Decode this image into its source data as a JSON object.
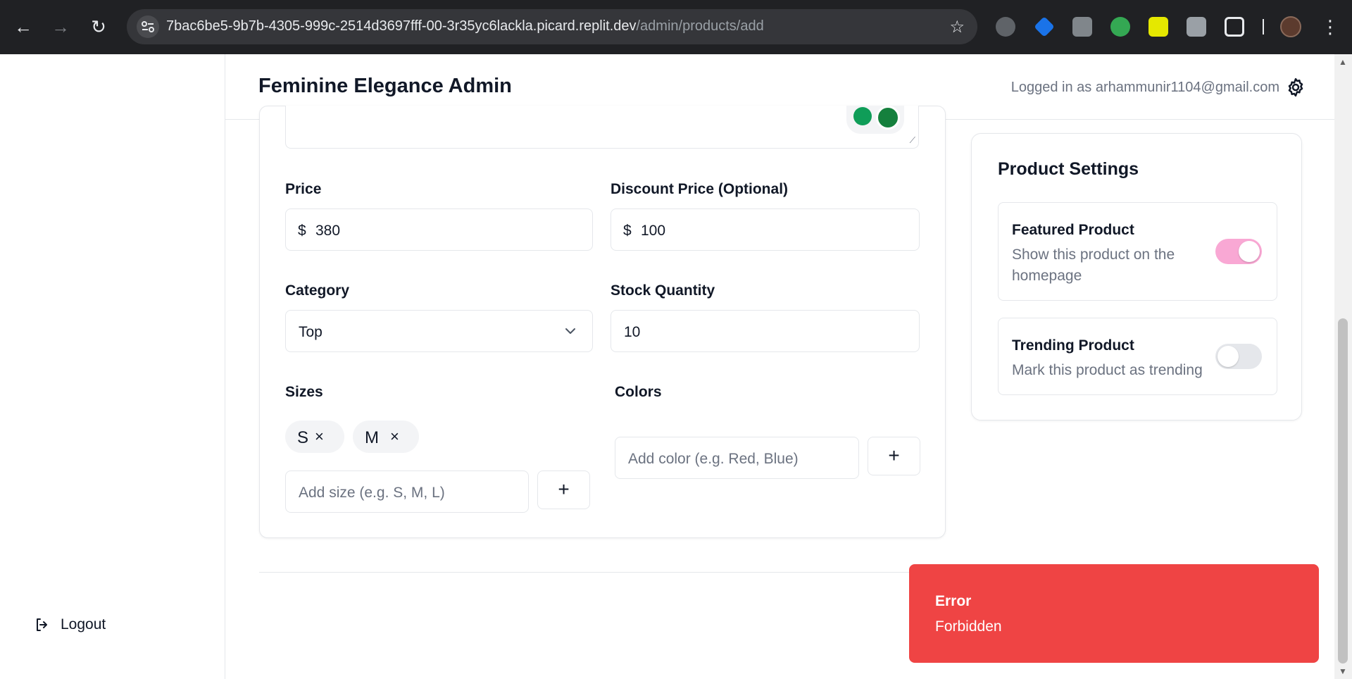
{
  "browser": {
    "url_host": "7bac6be5-9b7b-4305-999c-2514d3697fff-00-3r35yc6lackla.picard.replit.dev",
    "url_path": "/admin/products/add",
    "back_icon": "←",
    "forward_icon": "→",
    "reload_icon": "↻",
    "star_icon": "☆",
    "menu_icon": "⋮"
  },
  "header": {
    "brand": "Feminine Elegance Admin",
    "logged_in": "Logged in as arhammunir1104@gmail.com"
  },
  "sidebar": {
    "logout": "Logout"
  },
  "form": {
    "price_label": "Price",
    "price_prefix": "$",
    "price_value": "380",
    "discount_label": "Discount Price (Optional)",
    "discount_prefix": "$",
    "discount_value": "100",
    "category_label": "Category",
    "category_value": "Top",
    "stock_label": "Stock Quantity",
    "stock_value": "10",
    "sizes_label": "Sizes",
    "sizes": [
      {
        "label": "S",
        "remove": "×"
      },
      {
        "label": "M",
        "remove": "×"
      }
    ],
    "size_placeholder": "Add size (e.g. S, M, L)",
    "colors_label": "Colors",
    "color_placeholder": "Add color (e.g. Red, Blue)",
    "add_button": "+"
  },
  "settings": {
    "title": "Product Settings",
    "featured_title": "Featured Product",
    "featured_desc": "Show this product on the homepage",
    "featured_on": true,
    "trending_title": "Trending Product",
    "trending_desc": "Mark this product as trending",
    "trending_on": false
  },
  "toast": {
    "title": "Error",
    "message": "Forbidden"
  },
  "colors": {
    "toast_bg": "#ef4444",
    "toggle_on": "#f9a8d4",
    "toggle_off": "#e5e7eb"
  }
}
